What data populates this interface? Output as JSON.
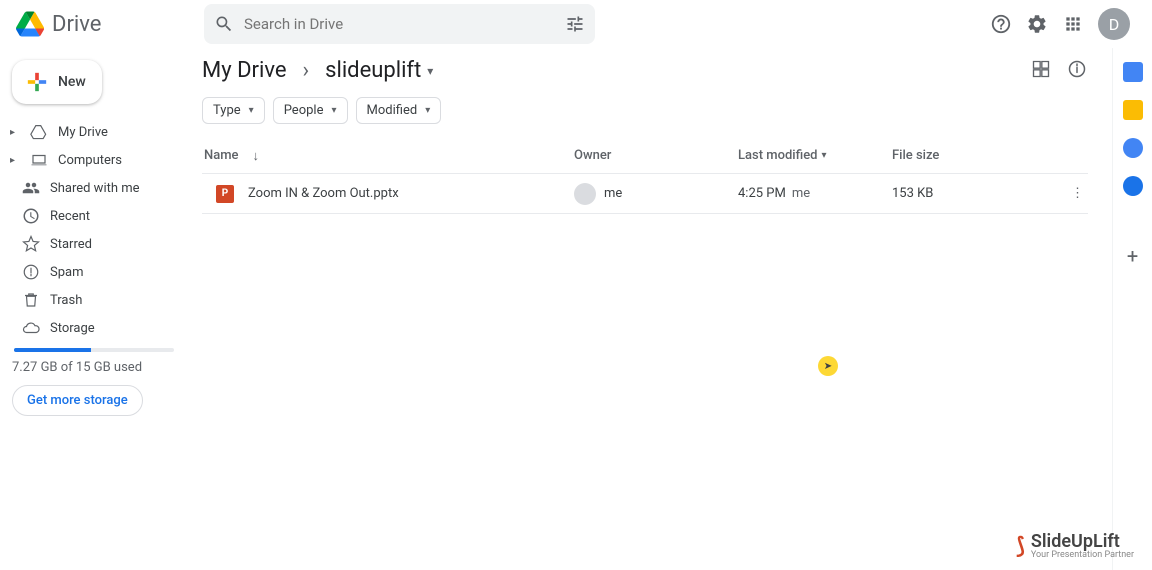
{
  "app": {
    "name": "Drive"
  },
  "search": {
    "placeholder": "Search in Drive"
  },
  "avatar": {
    "initial": "D"
  },
  "newButton": {
    "label": "New"
  },
  "sidebar": {
    "items": [
      {
        "label": "My Drive"
      },
      {
        "label": "Computers"
      },
      {
        "label": "Shared with me"
      },
      {
        "label": "Recent"
      },
      {
        "label": "Starred"
      },
      {
        "label": "Spam"
      },
      {
        "label": "Trash"
      },
      {
        "label": "Storage"
      }
    ],
    "storageText": "7.27 GB of 15 GB used",
    "getMore": "Get more storage"
  },
  "breadcrumb": {
    "root": "My Drive",
    "current": "slideuplift"
  },
  "filters": {
    "type": "Type",
    "people": "People",
    "modified": "Modified"
  },
  "columns": {
    "name": "Name",
    "owner": "Owner",
    "modified": "Last modified",
    "size": "File size"
  },
  "rows": [
    {
      "name": "Zoom IN & Zoom Out.pptx",
      "owner": "me",
      "modTime": "4:25 PM",
      "modBy": "me",
      "size": "153 KB"
    }
  ],
  "brand": {
    "name": "SlideUpLift",
    "tag": "Your Presentation Partner"
  }
}
